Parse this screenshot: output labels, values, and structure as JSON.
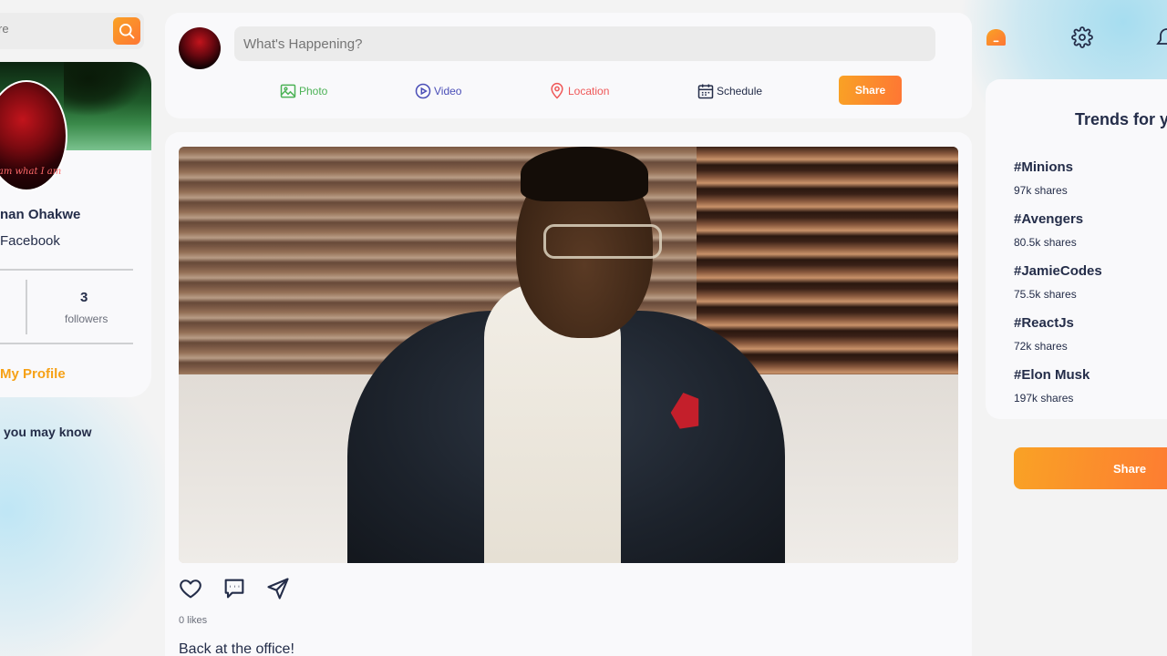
{
  "colors": {
    "accent_start": "#f9a225",
    "accent_end": "#fe7634",
    "photo": "#4cb256",
    "video": "#4a4eb7",
    "location": "#ef5757",
    "text": "#242d49"
  },
  "search": {
    "placeholder": "re"
  },
  "profile": {
    "avatar_text": "I am what I am",
    "name": "nan Ohakwe",
    "bio": "Facebook",
    "followers_count": "3",
    "followers_label": "followers",
    "my_profile_link": "My Profile",
    "may_know_heading": "you may know"
  },
  "share": {
    "placeholder": "What's Happening?",
    "options": {
      "photo": "Photo",
      "video": "Video",
      "location": "Location",
      "schedule": "Schedule"
    },
    "button": "Share"
  },
  "post": {
    "likes": "0 likes",
    "caption": "Back at the office!",
    "actions": [
      "heart-icon",
      "comment-icon",
      "send-icon"
    ]
  },
  "nav_icons": [
    "home-icon",
    "gear-icon",
    "bell-icon"
  ],
  "trends": {
    "title": "Trends for y",
    "items": [
      {
        "tag": "#Minions",
        "count": "97k shares"
      },
      {
        "tag": "#Avengers",
        "count": "80.5k shares"
      },
      {
        "tag": "#JamieCodes",
        "count": "75.5k shares"
      },
      {
        "tag": "#ReactJs",
        "count": "72k shares"
      },
      {
        "tag": "#Elon Musk",
        "count": "197k shares"
      }
    ]
  },
  "side_share_button": "Share"
}
